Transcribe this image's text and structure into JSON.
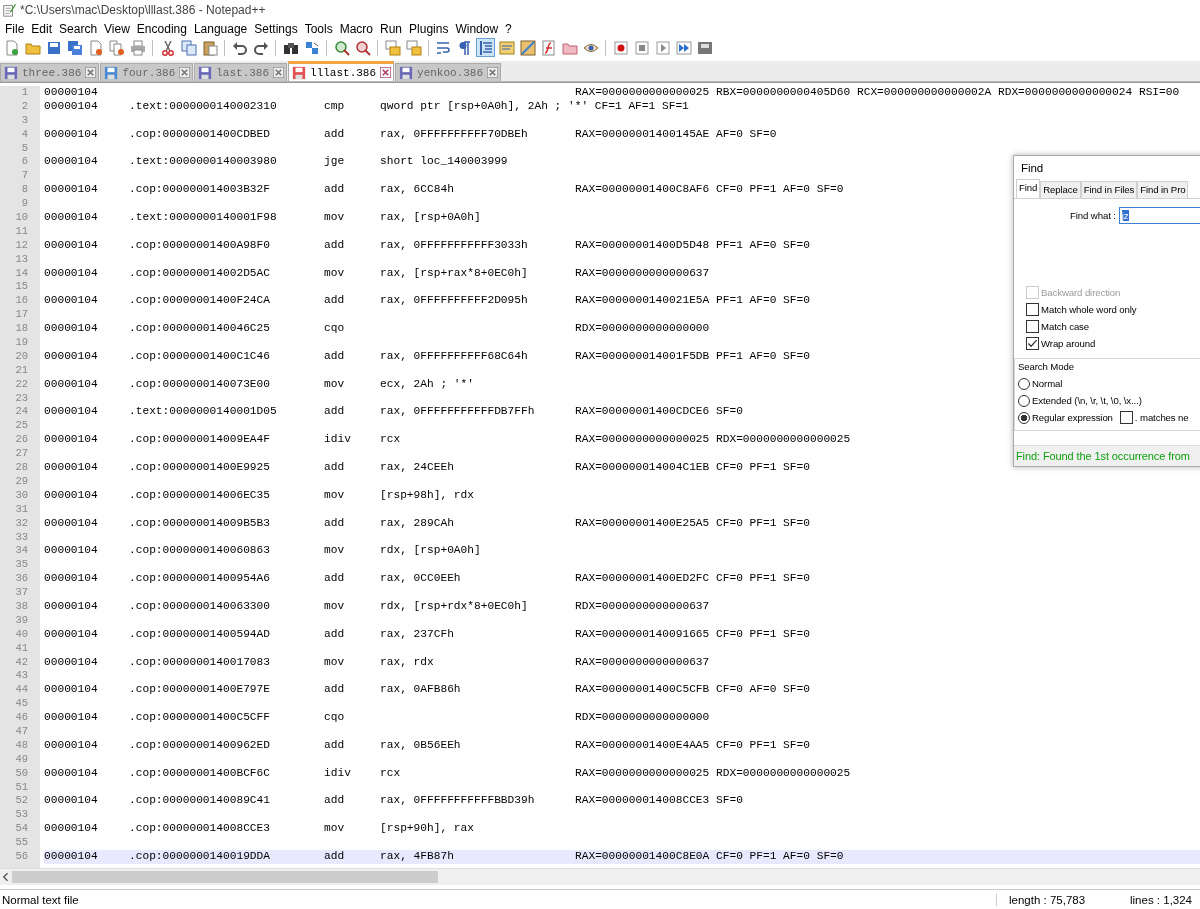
{
  "window": {
    "title": "*C:\\Users\\mac\\Desktop\\lllast.386 - Notepad++"
  },
  "menu": [
    "File",
    "Edit",
    "Search",
    "View",
    "Encoding",
    "Language",
    "Settings",
    "Tools",
    "Macro",
    "Run",
    "Plugins",
    "Window",
    "?"
  ],
  "toolbar": [
    {
      "kind": "new",
      "on": false
    },
    {
      "kind": "open",
      "on": false
    },
    {
      "kind": "save",
      "on": false
    },
    {
      "kind": "saveall",
      "on": false
    },
    {
      "kind": "close",
      "on": false
    },
    {
      "kind": "closeall",
      "on": false
    },
    {
      "kind": "print",
      "on": false
    },
    {
      "kind": "sep"
    },
    {
      "kind": "cut",
      "on": false
    },
    {
      "kind": "copy",
      "on": false
    },
    {
      "kind": "paste",
      "on": false
    },
    {
      "kind": "sep"
    },
    {
      "kind": "undo",
      "on": false
    },
    {
      "kind": "redo",
      "on": false
    },
    {
      "kind": "sep"
    },
    {
      "kind": "find",
      "on": false
    },
    {
      "kind": "replace",
      "on": false
    },
    {
      "kind": "sep"
    },
    {
      "kind": "zoomin",
      "on": false
    },
    {
      "kind": "zoomout",
      "on": false
    },
    {
      "kind": "sep"
    },
    {
      "kind": "syncv",
      "on": false
    },
    {
      "kind": "synch",
      "on": false
    },
    {
      "kind": "sep"
    },
    {
      "kind": "wrap",
      "on": false
    },
    {
      "kind": "pilcrow",
      "on": false
    },
    {
      "kind": "indent",
      "on": true
    },
    {
      "kind": "lang",
      "on": false
    },
    {
      "kind": "map",
      "on": false
    },
    {
      "kind": "func",
      "on": false
    },
    {
      "kind": "folder",
      "on": false
    },
    {
      "kind": "eye",
      "on": false
    },
    {
      "kind": "sep"
    },
    {
      "kind": "record",
      "on": false
    },
    {
      "kind": "stop",
      "on": false
    },
    {
      "kind": "play",
      "on": false
    },
    {
      "kind": "playmulti",
      "on": false
    },
    {
      "kind": "savemacro",
      "on": false
    }
  ],
  "tabs": [
    {
      "label": "three.386",
      "selected": false,
      "color": "#6a6ab8"
    },
    {
      "label": "four.386",
      "selected": false,
      "color": "#4a8ad0"
    },
    {
      "label": "last.386",
      "selected": false,
      "color": "#6a6ab8"
    },
    {
      "label": "lllast.386",
      "selected": true,
      "color": "#e05050"
    },
    {
      "label": "yenkoo.386",
      "selected": false,
      "color": "#6a6ab8"
    }
  ],
  "editor": {
    "lines": [
      {
        "number": "1",
        "column_1": "00000104",
        "registers": "RAX=0000000000000025 RBX=0000000000405D60 RCX=000000000000002A RDX=0000000000000024 RSI=00"
      },
      {
        "number": "2",
        "column_1": "00000104",
        "location": ".text:0000000140002310",
        "mnemonic": "cmp",
        "operand": "qword ptr [rsp+0A0h], 2Ah ; '*' CF=1 AF=1 SF=1"
      },
      {
        "number": "3"
      },
      {
        "number": "4",
        "column_1": "00000104",
        "location": ".cop:00000001400CDBED",
        "mnemonic": "add",
        "operand": "rax, 0FFFFFFFFFF70DBEh",
        "registers": "RAX=00000001400145AE AF=0 SF=0"
      },
      {
        "number": "5"
      },
      {
        "number": "6",
        "column_1": "00000104",
        "location": ".text:0000000140003980",
        "mnemonic": "jge",
        "operand": "short loc_140003999"
      },
      {
        "number": "7"
      },
      {
        "number": "8",
        "column_1": "00000104",
        "location": ".cop:000000014003B32F",
        "mnemonic": "add",
        "operand": "rax, 6CC84h",
        "registers": "RAX=00000001400C8AF6 CF=0 PF=1 AF=0 SF=0"
      },
      {
        "number": "9"
      },
      {
        "number": "10",
        "column_1": "00000104",
        "location": ".text:0000000140001F98",
        "mnemonic": "mov",
        "operand": "rax, [rsp+0A0h]"
      },
      {
        "number": "11"
      },
      {
        "number": "12",
        "column_1": "00000104",
        "location": ".cop:00000001400A98F0",
        "mnemonic": "add",
        "operand": "rax, 0FFFFFFFFFFF3033h",
        "registers": "RAX=00000001400D5D48 PF=1 AF=0 SF=0"
      },
      {
        "number": "13"
      },
      {
        "number": "14",
        "column_1": "00000104",
        "location": ".cop:000000014002D5AC",
        "mnemonic": "mov",
        "operand": "rax, [rsp+rax*8+0EC0h]",
        "registers": "RAX=0000000000000637"
      },
      {
        "number": "15"
      },
      {
        "number": "16",
        "column_1": "00000104",
        "location": ".cop:00000001400F24CA",
        "mnemonic": "add",
        "operand": "rax, 0FFFFFFFFFF2D095h",
        "registers": "RAX=0000000140021E5A PF=1 AF=0 SF=0"
      },
      {
        "number": "17"
      },
      {
        "number": "18",
        "column_1": "00000104",
        "location": ".cop:0000000140046C25",
        "mnemonic": "cqo",
        "registers": "RDX=0000000000000000"
      },
      {
        "number": "19"
      },
      {
        "number": "20",
        "column_1": "00000104",
        "location": ".cop:00000001400C1C46",
        "mnemonic": "add",
        "operand": "rax, 0FFFFFFFFFF68C64h",
        "registers": "RAX=000000014001F5DB PF=1 AF=0 SF=0"
      },
      {
        "number": "21"
      },
      {
        "number": "22",
        "column_1": "00000104",
        "location": ".cop:0000000140073E00",
        "mnemonic": "mov",
        "operand": "ecx, 2Ah ; '*'"
      },
      {
        "number": "23"
      },
      {
        "number": "24",
        "column_1": "00000104",
        "location": ".text:0000000140001D05",
        "mnemonic": "add",
        "operand": "rax, 0FFFFFFFFFFFDB7FFh",
        "registers": "RAX=00000001400CDCE6 SF=0"
      },
      {
        "number": "25"
      },
      {
        "number": "26",
        "column_1": "00000104",
        "location": ".cop:000000014009EA4F",
        "mnemonic": "idiv",
        "operand": "rcx",
        "registers": "RAX=0000000000000025 RDX=0000000000000025"
      },
      {
        "number": "27"
      },
      {
        "number": "28",
        "column_1": "00000104",
        "location": ".cop:00000001400E9925",
        "mnemonic": "add",
        "operand": "rax, 24CEEh",
        "registers": "RAX=000000014004C1EB CF=0 PF=1 SF=0"
      },
      {
        "number": "29"
      },
      {
        "number": "30",
        "column_1": "00000104",
        "location": ".cop:000000014006EC35",
        "mnemonic": "mov",
        "operand": "[rsp+98h], rdx"
      },
      {
        "number": "31"
      },
      {
        "number": "32",
        "column_1": "00000104",
        "location": ".cop:000000014009B5B3",
        "mnemonic": "add",
        "operand": "rax, 289CAh",
        "registers": "RAX=00000001400E25A5 CF=0 PF=1 SF=0"
      },
      {
        "number": "33"
      },
      {
        "number": "34",
        "column_1": "00000104",
        "location": ".cop:0000000140060863",
        "mnemonic": "mov",
        "operand": "rdx, [rsp+0A0h]"
      },
      {
        "number": "35"
      },
      {
        "number": "36",
        "column_1": "00000104",
        "location": ".cop:00000001400954A6",
        "mnemonic": "add",
        "operand": "rax, 0CC0EEh",
        "registers": "RAX=00000001400ED2FC CF=0 PF=1 SF=0"
      },
      {
        "number": "37"
      },
      {
        "number": "38",
        "column_1": "00000104",
        "location": ".cop:0000000140063300",
        "mnemonic": "mov",
        "operand": "rdx, [rsp+rdx*8+0EC0h]",
        "registers": "RDX=0000000000000637"
      },
      {
        "number": "39"
      },
      {
        "number": "40",
        "column_1": "00000104",
        "location": ".cop:00000001400594AD",
        "mnemonic": "add",
        "operand": "rax, 237CFh",
        "registers": "RAX=0000000140091665 CF=0 PF=1 SF=0"
      },
      {
        "number": "41"
      },
      {
        "number": "42",
        "column_1": "00000104",
        "location": ".cop:0000000140017083",
        "mnemonic": "mov",
        "operand": "rax, rdx",
        "registers": "RAX=0000000000000637"
      },
      {
        "number": "43"
      },
      {
        "number": "44",
        "column_1": "00000104",
        "location": ".cop:00000001400E797E",
        "mnemonic": "add",
        "operand": "rax, 0AFB86h",
        "registers": "RAX=00000001400C5CFB CF=0 AF=0 SF=0"
      },
      {
        "number": "45"
      },
      {
        "number": "46",
        "column_1": "00000104",
        "location": ".cop:00000001400C5CFF",
        "mnemonic": "cqo",
        "registers": "RDX=0000000000000000"
      },
      {
        "number": "47"
      },
      {
        "number": "48",
        "column_1": "00000104",
        "location": ".cop:00000001400962ED",
        "mnemonic": "add",
        "operand": "rax, 0B56EEh",
        "registers": "RAX=00000001400E4AA5 CF=0 PF=1 SF=0"
      },
      {
        "number": "49"
      },
      {
        "number": "50",
        "column_1": "00000104",
        "location": ".cop:00000001400BCF6C",
        "mnemonic": "idiv",
        "operand": "rcx",
        "registers": "RAX=0000000000000025 RDX=0000000000000025"
      },
      {
        "number": "51"
      },
      {
        "number": "52",
        "column_1": "00000104",
        "location": ".cop:0000000140089C41",
        "mnemonic": "add",
        "operand": "rax, 0FFFFFFFFFFFBBD39h",
        "registers": "RAX=000000014008CCE3 SF=0"
      },
      {
        "number": "53"
      },
      {
        "number": "54",
        "column_1": "00000104",
        "location": ".cop:000000014008CCE3",
        "mnemonic": "mov",
        "operand": "[rsp+90h], rax"
      },
      {
        "number": "55"
      },
      {
        "number": "56",
        "column_1": "00000104",
        "location": ".cop:0000000140019DDA",
        "mnemonic": "add",
        "operand": "rax, 4FB87h",
        "registers": "RAX=00000001400C8E0A CF=0 PF=1 AF=0 SF=0",
        "current": true
      }
    ]
  },
  "find_dialog": {
    "title": "Find",
    "tabs": [
      {
        "label": "Find",
        "selected": true
      },
      {
        "label": "Replace",
        "selected": false
      },
      {
        "label": "Find in Files",
        "selected": false
      },
      {
        "label": "Find in Pro",
        "selected": false
      }
    ],
    "find_what": {
      "label": "Find what :",
      "value": "jz"
    },
    "options": [
      {
        "label": "Backward direction",
        "checked": false,
        "disabled": true
      },
      {
        "label": "Match whole word only",
        "checked": false,
        "disabled": false
      },
      {
        "label": "Match case",
        "checked": false,
        "disabled": false
      },
      {
        "label": "Wrap around",
        "checked": true,
        "disabled": false
      }
    ],
    "search_mode": {
      "title": "Search Mode",
      "modes": [
        {
          "label": "Normal",
          "selected": false
        },
        {
          "label": "Extended (\\n, \\r, \\t, \\0, \\x...)",
          "selected": false
        },
        {
          "label": "Regular expression",
          "selected": true
        }
      ],
      "matches_newline": {
        "label": ". matches ne",
        "checked": false
      }
    },
    "message": "Find: Found the 1st occurrence from"
  },
  "status_bar": {
    "file_type": "Normal text file",
    "length": "length : 75,783",
    "lines": "lines : 1,324"
  }
}
